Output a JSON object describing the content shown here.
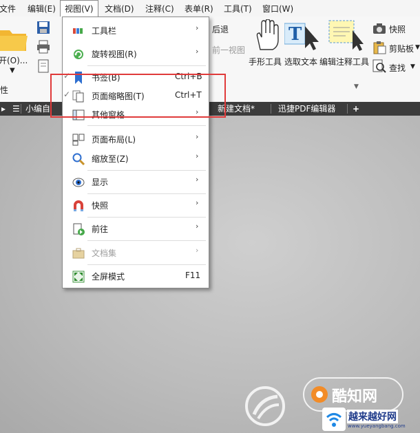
{
  "menubar": {
    "items": [
      "文件",
      "编辑(E)",
      "视图(V)",
      "文档(D)",
      "注释(C)",
      "表单(R)",
      "工具(T)",
      "窗口(W)"
    ]
  },
  "ribbon": {
    "left_partial": [
      "打开(O)...",
      "属性"
    ],
    "back": "后退",
    "prev_view": "前一视图",
    "hand_tool": "手形工具",
    "select_tool": "选取文本",
    "edit_annot_tool": "编辑注释工具",
    "snapshot": "快照",
    "clipboard": "剪贴板",
    "find": "查找"
  },
  "tabs": {
    "items": [
      "小编自",
      "新建文档",
      "迅捷PDF编辑器"
    ],
    "modified_mark": "*",
    "add": "+"
  },
  "view_menu": {
    "items": [
      {
        "label": "工具栏",
        "shortcut": "",
        "submenu": true,
        "checked": false,
        "disabled": false,
        "icon": "toolbar-icon"
      },
      {
        "label": "旋转视图(R)",
        "shortcut": "",
        "submenu": true,
        "checked": false,
        "disabled": false,
        "icon": "rotate-icon"
      },
      {
        "label": "书签(B)",
        "shortcut": "Ctrl+B",
        "submenu": false,
        "checked": true,
        "disabled": false,
        "icon": "bookmark-icon"
      },
      {
        "label": "页面缩略图(T)",
        "shortcut": "Ctrl+T",
        "submenu": false,
        "checked": true,
        "disabled": false,
        "icon": "thumbnails-icon"
      },
      {
        "label": "其他窗格",
        "shortcut": "",
        "submenu": true,
        "checked": false,
        "disabled": false,
        "icon": "panes-icon"
      },
      {
        "label": "页面布局(L)",
        "shortcut": "",
        "submenu": true,
        "checked": false,
        "disabled": false,
        "icon": "page-layout-icon"
      },
      {
        "label": "缩放至(Z)",
        "shortcut": "",
        "submenu": true,
        "checked": false,
        "disabled": false,
        "icon": "zoom-icon"
      },
      {
        "label": "显示",
        "shortcut": "",
        "submenu": true,
        "checked": false,
        "disabled": false,
        "icon": "eye-icon"
      },
      {
        "label": "快照",
        "shortcut": "",
        "submenu": true,
        "checked": false,
        "disabled": false,
        "icon": "magnet-icon"
      },
      {
        "label": "前往",
        "shortcut": "",
        "submenu": true,
        "checked": false,
        "disabled": false,
        "icon": "goto-icon"
      },
      {
        "label": "文档集",
        "shortcut": "",
        "submenu": true,
        "checked": false,
        "disabled": true,
        "icon": "portfolio-icon"
      },
      {
        "label": "全屏模式",
        "shortcut": "F11",
        "submenu": false,
        "checked": false,
        "disabled": false,
        "icon": "fullscreen-icon"
      }
    ],
    "submenu_arrow": "›",
    "check_mark": "✓"
  },
  "watermark": {
    "brand": "酷知网",
    "site_cn": "越来越好网",
    "site_url": "www.yueyangbang.com"
  },
  "colors": {
    "highlight_box": "#e03a3a",
    "tab_bar": "#3c3c3c"
  }
}
